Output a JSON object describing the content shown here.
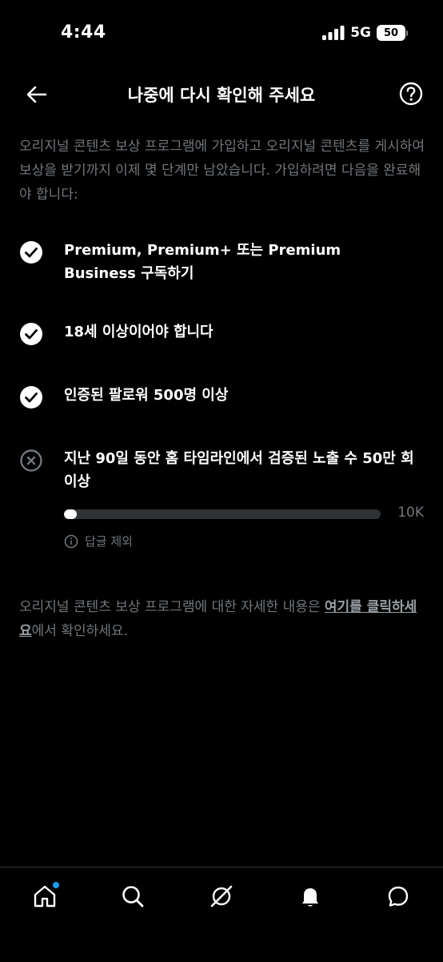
{
  "status_bar": {
    "time": "4:44",
    "network": "5G",
    "battery": "50"
  },
  "header": {
    "title": "나중에 다시 확인해 주세요"
  },
  "intro": "오리지널 콘텐츠 보상 프로그램에 가입하고 오리지널 콘텐츠를 게시하여 보상을 받기까지 이제 몇 단계만 남았습니다. 가입하려면 다음을 완료해야 합니다:",
  "requirements": [
    {
      "label": "Premium, Premium+ 또는 Premium Business 구독하기",
      "status": "done"
    },
    {
      "label": "18세 이상이어야 합니다",
      "status": "done"
    },
    {
      "label": "인증된 팔로워 500명 이상",
      "status": "done"
    },
    {
      "label": "지난 90일 동안 홈 타임라인에서 검증된 노출 수 50만 회 이상",
      "status": "not_done"
    }
  ],
  "impressions_progress": {
    "fraction": 0.04,
    "max_label": "10K"
  },
  "impressions_note": "답글 제외",
  "footer": {
    "prefix": "오리지널 콘텐츠 보상 프로그램에 대한 자세한 내용은 ",
    "link": "여기를 클릭하세요",
    "suffix": "에서 확인하세요."
  },
  "colors": {
    "background": "#000000",
    "text": "#e7e9ea",
    "muted": "#71767b",
    "accent": "#1d9bf0"
  },
  "icons": [
    "back-arrow-icon",
    "help-icon",
    "check-circle-icon",
    "x-circle-icon",
    "info-icon",
    "home-icon",
    "search-icon",
    "grok-icon",
    "bell-icon",
    "message-icon"
  ]
}
